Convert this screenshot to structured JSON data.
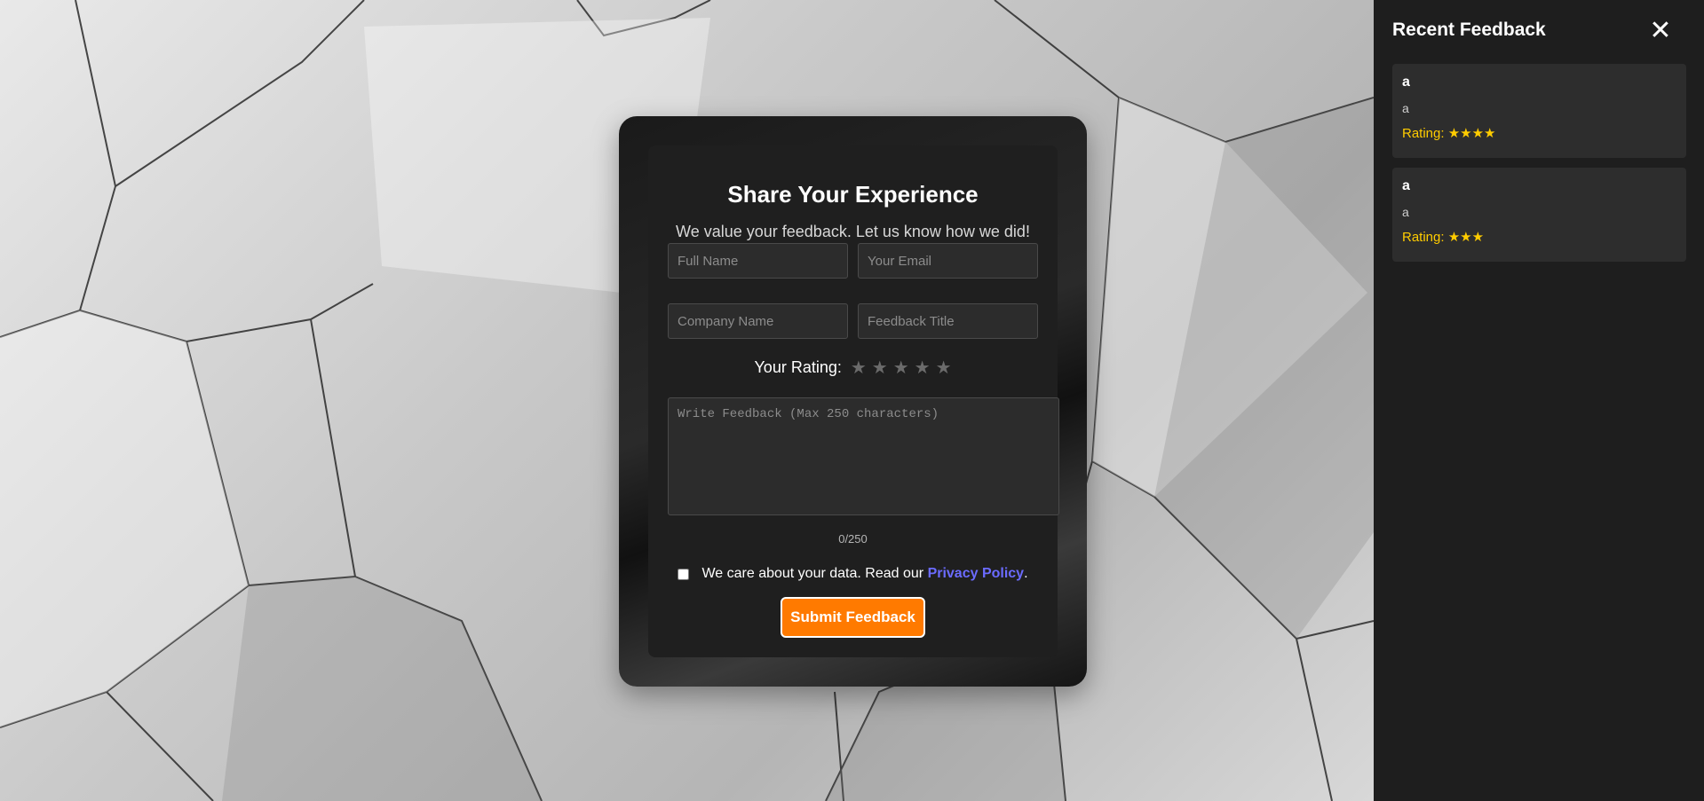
{
  "form": {
    "title": "Share Your Experience",
    "subtitle": "We value your feedback. Let us know how we did!",
    "fields": {
      "full_name_placeholder": "Full Name",
      "email_placeholder": "Your Email",
      "company_placeholder": "Company Name",
      "feedback_title_placeholder": "Feedback Title",
      "message_placeholder": "Write Feedback (Max 250 characters)"
    },
    "rating_label": "Your Rating:",
    "stars": [
      "★",
      "★",
      "★",
      "★",
      "★"
    ],
    "rating_value": 0,
    "char_counter": "0/250",
    "consent_text": "We care about your data. Read our",
    "privacy_link": "Privacy Policy",
    "consent_end": ".",
    "submit_label": "Submit Feedback",
    "colors": {
      "accent": "#ff7a00",
      "link": "#6b6bff",
      "star_empty": "#6b6b6b"
    }
  },
  "sidebar": {
    "title": "Recent Feedback",
    "close_glyph": "✕",
    "items": [
      {
        "title": "a",
        "body": "a",
        "rating_text": "Rating: ★★★★",
        "rating": 4
      },
      {
        "title": "a",
        "body": "a",
        "rating_text": "Rating: ★★★",
        "rating": 3
      }
    ],
    "colors": {
      "rating": "#ffcc00"
    }
  }
}
